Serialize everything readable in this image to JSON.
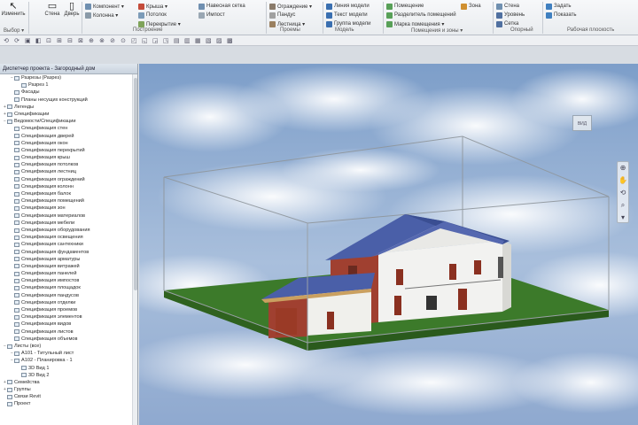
{
  "ribbon": {
    "big_buttons": [
      {
        "label": "Изменить",
        "icon": "select-arrow-icon"
      },
      {
        "label": "Стена",
        "icon": "wall-icon"
      },
      {
        "label": "Дверь",
        "icon": "door-icon"
      }
    ],
    "small_buttons": [
      {
        "label": "Компонент ▾",
        "icon": "component-icon",
        "color": "#6f8fb0"
      },
      {
        "label": "Колонна ▾",
        "icon": "column-icon",
        "color": "#8a9aa8"
      },
      {
        "label": "Крыша ▾",
        "icon": "roof-icon",
        "color": "#c44b3a"
      },
      {
        "label": "Потолок",
        "icon": "ceiling-icon",
        "color": "#7c9bb8"
      },
      {
        "label": "Перекрытие ▾",
        "icon": "floor-icon",
        "color": "#7fa35a"
      },
      {
        "label": "Навесная сетка",
        "icon": "curtain-grid-icon",
        "color": "#6f8fb0"
      },
      {
        "label": "Импост",
        "icon": "mullion-icon",
        "color": "#9aa7b3"
      },
      {
        "label": "Ограждение ▾",
        "icon": "railing-icon",
        "color": "#8a7b6a"
      },
      {
        "label": "Пандус",
        "icon": "ramp-icon",
        "color": "#a0a0a0"
      },
      {
        "label": "Лестница ▾",
        "icon": "stair-icon",
        "color": "#9a8060"
      },
      {
        "label": "Линия модели",
        "icon": "model-line-icon",
        "color": "#3a6fb0"
      },
      {
        "label": "Текст модели",
        "icon": "model-text-icon",
        "color": "#3a6fb0"
      },
      {
        "label": "Группа модели",
        "icon": "model-group-icon",
        "color": "#3a6fb0"
      },
      {
        "label": "Помещение",
        "icon": "room-icon",
        "color": "#58a058"
      },
      {
        "label": "Разделитель помещений",
        "icon": "room-separator-icon",
        "color": "#58a058"
      },
      {
        "label": "Марка помещения ▾",
        "icon": "room-tag-icon",
        "color": "#58a058"
      },
      {
        "label": "Зона",
        "icon": "area-icon",
        "color": "#d09030"
      },
      {
        "label": "Стена",
        "icon": "shaft-icon",
        "color": "#7090b0"
      },
      {
        "label": "Уровень",
        "icon": "level-icon",
        "color": "#5070a0"
      },
      {
        "label": "Сетка",
        "icon": "grid-icon",
        "color": "#5070a0"
      },
      {
        "label": "Задать",
        "icon": "set-plane-icon",
        "color": "#4080c0"
      },
      {
        "label": "Показать",
        "icon": "show-plane-icon",
        "color": "#4080c0"
      }
    ],
    "panels": [
      "Выбор ▾",
      "Построение",
      "Проемы",
      "Модель",
      "Помещения и зоны ▾",
      "Опорный",
      "Рабочая плоскость"
    ]
  },
  "quick_access": [
    "⟲",
    "⟳",
    "▣",
    "◧",
    "⊡",
    "⊞",
    "⊟",
    "⊠",
    "⊕",
    "⊗",
    "⊘",
    "⊙",
    "◰",
    "◱",
    "◲",
    "◳",
    "▤",
    "▥",
    "▦",
    "▧",
    "▨",
    "▩"
  ],
  "browser": {
    "title": "Диспетчер проекта - Загородный дом",
    "items": [
      {
        "indent": 1,
        "toggle": "−",
        "text": "Разрезы (Разрез)"
      },
      {
        "indent": 2,
        "toggle": "",
        "text": "Разрез 1"
      },
      {
        "indent": 1,
        "toggle": "",
        "text": "Фасады"
      },
      {
        "indent": 1,
        "toggle": "",
        "text": "Планы несущих конструкций"
      },
      {
        "indent": 0,
        "toggle": "+",
        "text": "Легенды"
      },
      {
        "indent": 0,
        "toggle": "+",
        "text": "Спецификации"
      },
      {
        "indent": 0,
        "toggle": "−",
        "text": "Ведомости/Спецификации"
      },
      {
        "indent": 1,
        "toggle": "",
        "text": "Спецификация стен"
      },
      {
        "indent": 1,
        "toggle": "",
        "text": "Спецификация дверей"
      },
      {
        "indent": 1,
        "toggle": "",
        "text": "Спецификация окон"
      },
      {
        "indent": 1,
        "toggle": "",
        "text": "Спецификация перекрытий"
      },
      {
        "indent": 1,
        "toggle": "",
        "text": "Спецификация крыш"
      },
      {
        "indent": 1,
        "toggle": "",
        "text": "Спецификация потолков"
      },
      {
        "indent": 1,
        "toggle": "",
        "text": "Спецификация лестниц"
      },
      {
        "indent": 1,
        "toggle": "",
        "text": "Спецификация ограждений"
      },
      {
        "indent": 1,
        "toggle": "",
        "text": "Спецификация колонн"
      },
      {
        "indent": 1,
        "toggle": "",
        "text": "Спецификация балок"
      },
      {
        "indent": 1,
        "toggle": "",
        "text": "Спецификация помещений"
      },
      {
        "indent": 1,
        "toggle": "",
        "text": "Спецификация зон"
      },
      {
        "indent": 1,
        "toggle": "",
        "text": "Спецификация материалов"
      },
      {
        "indent": 1,
        "toggle": "",
        "text": "Спецификация мебели"
      },
      {
        "indent": 1,
        "toggle": "",
        "text": "Спецификация оборудования"
      },
      {
        "indent": 1,
        "toggle": "",
        "text": "Спецификация освещения"
      },
      {
        "indent": 1,
        "toggle": "",
        "text": "Спецификация сантехники"
      },
      {
        "indent": 1,
        "toggle": "",
        "text": "Спецификация фундаментов"
      },
      {
        "indent": 1,
        "toggle": "",
        "text": "Спецификация арматуры"
      },
      {
        "indent": 1,
        "toggle": "",
        "text": "Спецификация витражей"
      },
      {
        "indent": 1,
        "toggle": "",
        "text": "Спецификация панелей"
      },
      {
        "indent": 1,
        "toggle": "",
        "text": "Спецификация импостов"
      },
      {
        "indent": 1,
        "toggle": "",
        "text": "Спецификация площадок"
      },
      {
        "indent": 1,
        "toggle": "",
        "text": "Спецификация пандусов"
      },
      {
        "indent": 1,
        "toggle": "",
        "text": "Спецификация отделки"
      },
      {
        "indent": 1,
        "toggle": "",
        "text": "Спецификация проемов"
      },
      {
        "indent": 1,
        "toggle": "",
        "text": "Спецификация элементов"
      },
      {
        "indent": 1,
        "toggle": "",
        "text": "Спецификация видов"
      },
      {
        "indent": 1,
        "toggle": "",
        "text": "Спецификация листов"
      },
      {
        "indent": 1,
        "toggle": "",
        "text": "Спецификация объемов"
      },
      {
        "indent": 0,
        "toggle": "−",
        "text": "Листы (все)"
      },
      {
        "indent": 1,
        "toggle": "−",
        "text": "А101 - Титульный лист"
      },
      {
        "indent": 1,
        "toggle": "−",
        "text": "А102 - Планировка - 1"
      },
      {
        "indent": 2,
        "toggle": "",
        "text": "3D Вид 1"
      },
      {
        "indent": 2,
        "toggle": "",
        "text": "3D Вид 2"
      },
      {
        "indent": 0,
        "toggle": "+",
        "text": "Семейства"
      },
      {
        "indent": 0,
        "toggle": "+",
        "text": "Группы"
      },
      {
        "indent": 0,
        "toggle": "",
        "text": "Связи Revit"
      },
      {
        "indent": 0,
        "toggle": "",
        "text": "Проект"
      }
    ]
  },
  "viewcube": {
    "face": "ВИД"
  },
  "navbar": [
    "⊕",
    "✋",
    "⟲",
    "⌕",
    "▾"
  ],
  "colors": {
    "sky_top": "#7d9ec9",
    "sky_bottom": "#c9d6e6",
    "ground": "#3c7a2a",
    "roof": "#4a5fa8",
    "brick": "#a04030",
    "wall_white": "#f2f2f0",
    "section_box": "#8f969c"
  }
}
